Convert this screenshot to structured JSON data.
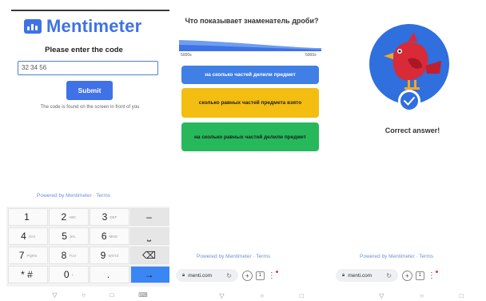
{
  "join": {
    "brand": "Mentimeter",
    "prompt": "Please enter the code",
    "code_value": "32 34 56",
    "submit_label": "Submit",
    "hint": "The code is found on the screen in front of you",
    "powered": "Powered by Mentimeter · Terms"
  },
  "keyboard": {
    "keys": [
      {
        "d": "1",
        "s": ""
      },
      {
        "d": "2",
        "s": "ABC"
      },
      {
        "d": "3",
        "s": "DEF"
      },
      {
        "d": "–",
        "s": ""
      },
      {
        "d": "4",
        "s": "GHI"
      },
      {
        "d": "5",
        "s": "JKL"
      },
      {
        "d": "6",
        "s": "MNO"
      },
      {
        "d": "⎵",
        "s": ""
      },
      {
        "d": "7",
        "s": "PQRS"
      },
      {
        "d": "8",
        "s": "TUV"
      },
      {
        "d": "9",
        "s": "WXYZ"
      },
      {
        "d": "⌫",
        "s": ""
      },
      {
        "d": "* #",
        "s": ""
      },
      {
        "d": "0",
        "s": "+"
      },
      {
        "d": ".",
        "s": ""
      },
      {
        "d": "→",
        "s": ""
      }
    ]
  },
  "nav": [
    "▽",
    "○",
    "□",
    "⌨"
  ],
  "quiz": {
    "question": "Что показывает знаменатель дроби?",
    "scale_left": "5000s",
    "scale_right": "5000s",
    "options": [
      "на сколько частей делили предмет",
      "сколько равных частей предмета взято",
      "на сколько равных частей делили предмет"
    ],
    "powered": "Powered by Mentimeter · Terms",
    "url": "menti.com"
  },
  "result": {
    "message": "Correct answer!",
    "powered": "Powered by Mentimeter · Terms",
    "url": "menti.com"
  },
  "colors": {
    "brand_blue": "#3f72e6",
    "option_blue": "#3f7fe6",
    "option_yellow": "#f3bd11",
    "option_green": "#27b85b",
    "bird_red": "#d92a38",
    "avatar_bg": "#2f6fde"
  },
  "icons": [
    "logo-icon",
    "lock-icon",
    "reload-icon",
    "add-tab-icon",
    "tabs-icon",
    "menu-icon",
    "check-icon",
    "bird-avatar"
  ]
}
